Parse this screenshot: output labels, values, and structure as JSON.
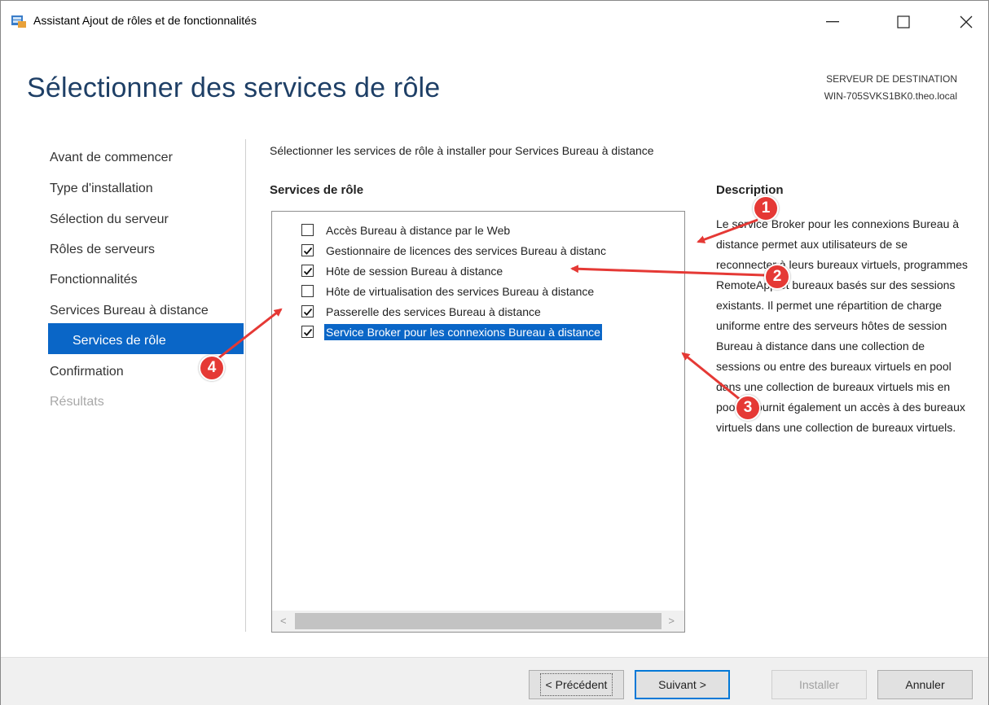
{
  "window": {
    "title": "Assistant Ajout de rôles et de fonctionnalités",
    "controls": {
      "minimize": "—",
      "maximize": "☐",
      "close": "✕"
    },
    "icon": "server-manager-icon"
  },
  "header": {
    "title": "Sélectionner des services de rôle",
    "destination_label": "SERVEUR DE DESTINATION",
    "destination_server": "WIN-705SVKS1BK0.theo.local"
  },
  "nav": {
    "items": [
      {
        "label": "Avant de commencer",
        "state": "normal"
      },
      {
        "label": "Type d'installation",
        "state": "normal"
      },
      {
        "label": "Sélection du serveur",
        "state": "normal"
      },
      {
        "label": "Rôles de serveurs",
        "state": "normal"
      },
      {
        "label": "Fonctionnalités",
        "state": "normal"
      },
      {
        "label": "Services Bureau à distance",
        "state": "normal"
      },
      {
        "label": "Services de rôle",
        "state": "selected"
      },
      {
        "label": "Confirmation",
        "state": "normal"
      },
      {
        "label": "Résultats",
        "state": "disabled"
      }
    ]
  },
  "content": {
    "intro": "Sélectionner les services de rôle à installer pour Services Bureau à distance",
    "list_title": "Services de rôle",
    "role_services": [
      {
        "label": "Accès Bureau à distance par le Web",
        "checked": false
      },
      {
        "label": "Gestionnaire de licences des services Bureau à distanc",
        "checked": true
      },
      {
        "label": "Hôte de session Bureau à distance",
        "checked": true
      },
      {
        "label": "Hôte de virtualisation des services Bureau à distance",
        "checked": false
      },
      {
        "label": "Passerelle des services Bureau à distance",
        "checked": true
      },
      {
        "label": "Service Broker pour les connexions Bureau à distance",
        "checked": true,
        "selected": true
      }
    ],
    "scroll_left": "<",
    "scroll_right": ">",
    "description_title": "Description",
    "description": "Le service Broker pour les connexions Bureau à distance permet aux utilisateurs de se reconnecter à leurs bureaux virtuels, programmes RemoteApp et bureaux basés sur des sessions existants. Il permet une répartition de charge uniforme entre des serveurs hôtes de session Bureau à distance dans une collection de sessions ou entre des bureaux virtuels en pool dans une collection de bureaux virtuels mis en pool. Il fournit également un accès à des bureaux virtuels dans une collection de bureaux virtuels."
  },
  "footer": {
    "previous": "< Précédent",
    "next": "Suivant >",
    "install": "Installer",
    "cancel": "Annuler"
  },
  "annotations": {
    "badges": [
      "1",
      "2",
      "3",
      "4"
    ],
    "color": "#e53935"
  },
  "colors": {
    "accent": "#0a66c7",
    "title": "#1e3f66"
  }
}
